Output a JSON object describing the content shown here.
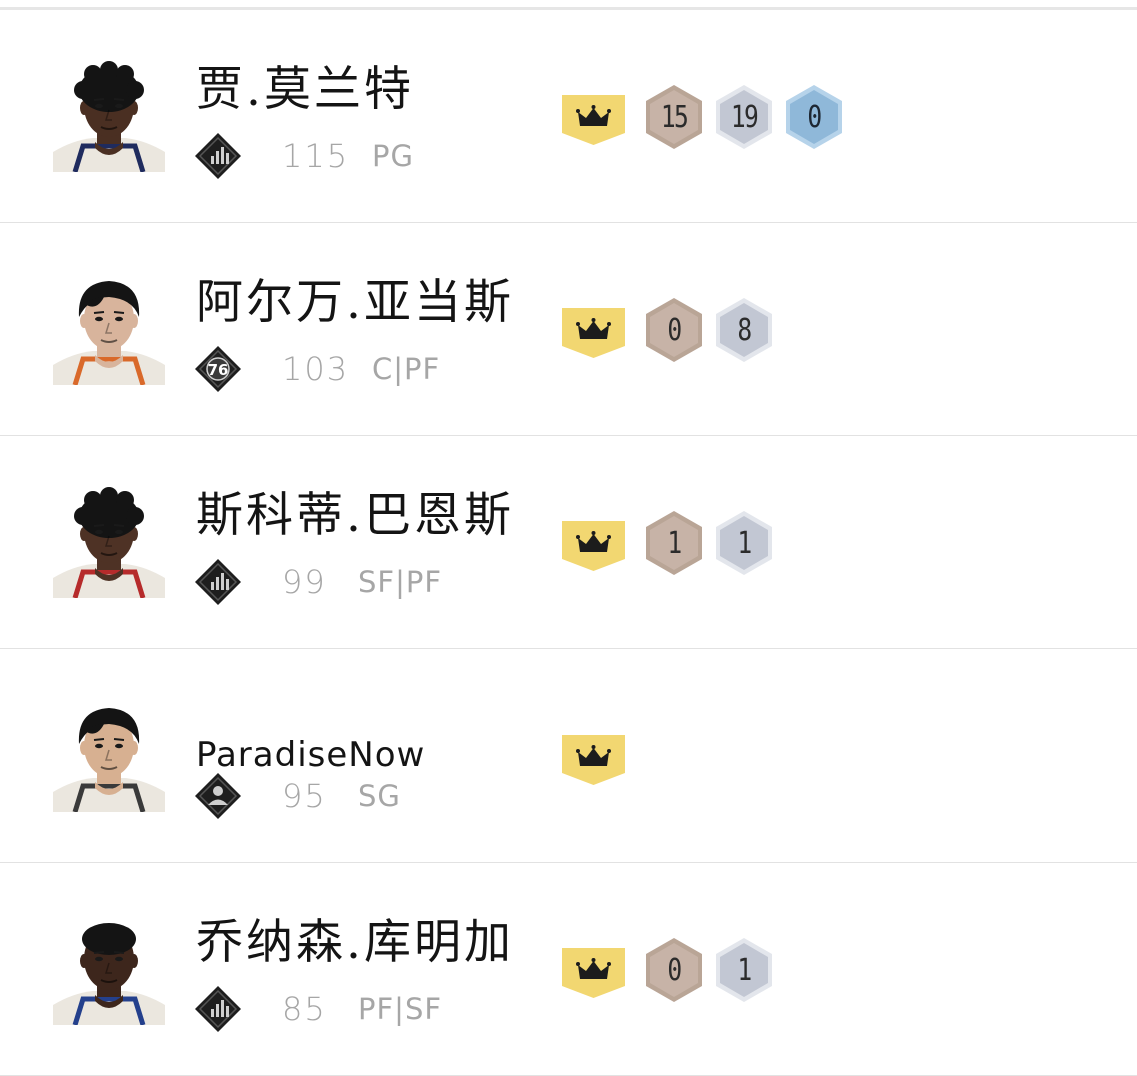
{
  "players": [
    {
      "name": "贾.莫兰特",
      "rating": "115",
      "position": "PG",
      "team_icon": "bars-chart-icon",
      "jersey": "navy",
      "skin": "#4a2f22",
      "hair": "curly",
      "badges": {
        "bronze": "15",
        "silver": "19",
        "gold": "0"
      }
    },
    {
      "name": "阿尔万.亚当斯",
      "rating": "103",
      "position": "C|PF",
      "team_icon": "76-logo-icon",
      "team_icon_text": "76",
      "jersey": "orange",
      "skin": "#d8b49c",
      "hair": "straight",
      "badges": {
        "bronze": "0",
        "silver": "8"
      }
    },
    {
      "name": "斯科蒂.巴恩斯",
      "rating": "99",
      "position": "SF|PF",
      "team_icon": "bars-chart-icon",
      "jersey": "red",
      "skin": "#4e3225",
      "hair": "curly",
      "badges": {
        "bronze": "1",
        "silver": "1"
      }
    },
    {
      "name": "ParadiseNow",
      "rating": "95",
      "position": "SG",
      "team_icon": "person-icon",
      "jersey": "grey",
      "skin": "#d7b091",
      "hair": "straight",
      "badges": {}
    },
    {
      "name": "乔纳森.库明加",
      "rating": "85",
      "position": "PF|SF",
      "team_icon": "bars-chart-icon",
      "jersey": "blue",
      "skin": "#3d261c",
      "hair": "short",
      "badges": {
        "bronze": "0",
        "silver": "1"
      }
    }
  ],
  "colors": {
    "crown_bg": "#f2d771",
    "bronze": "#c7b3a7",
    "silver": "#c2c7d3",
    "gold": "#8fb8d9",
    "team_badge": "#1e1e1e"
  }
}
